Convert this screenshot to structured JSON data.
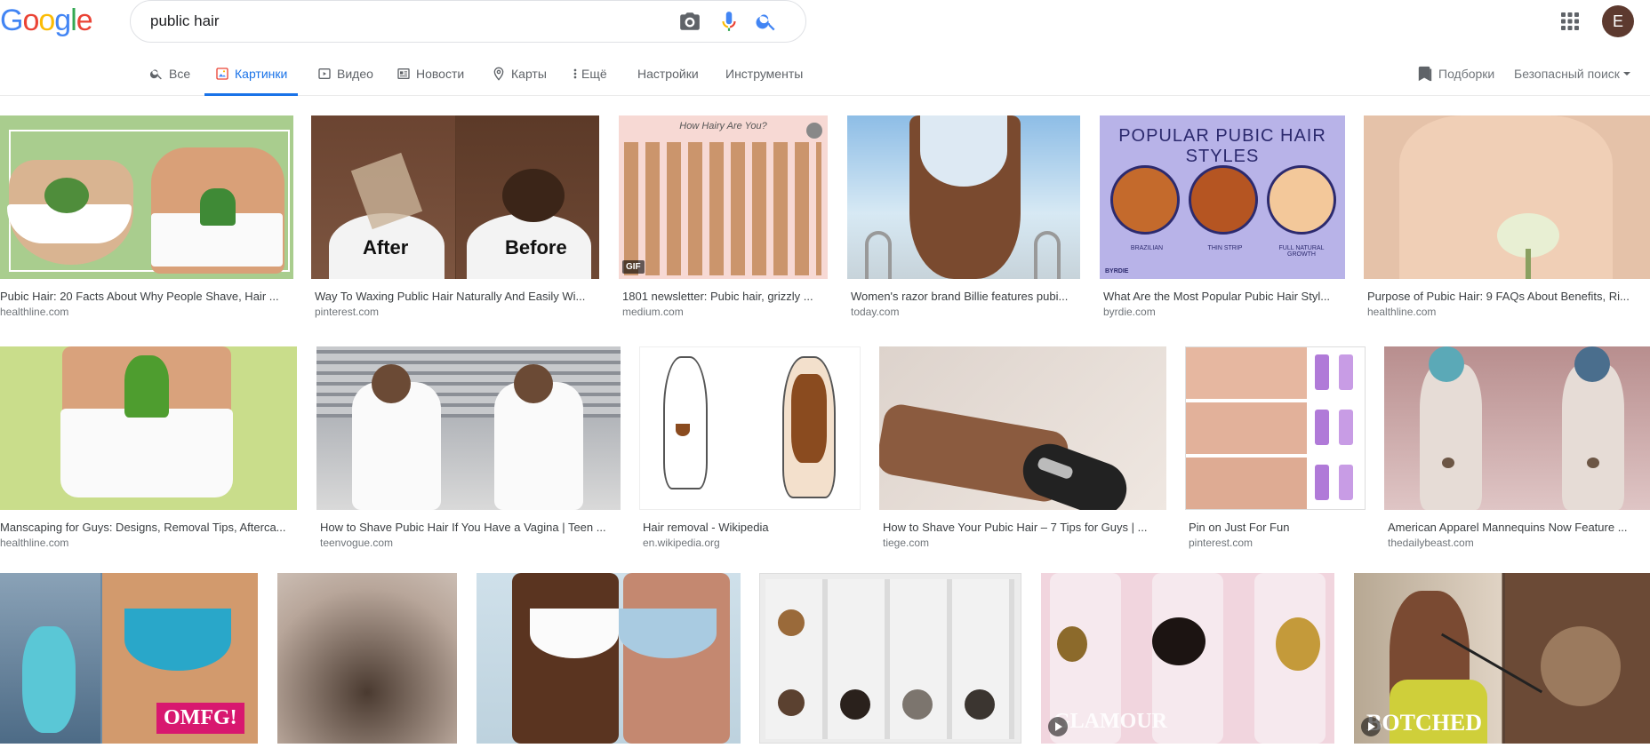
{
  "logo": {
    "letters": [
      "G",
      "o",
      "o",
      "g",
      "l",
      "e"
    ],
    "colors": [
      "#4285F4",
      "#EA4335",
      "#FBBC05",
      "#4285F4",
      "#34A853",
      "#EA4335"
    ]
  },
  "search": {
    "query": "public hair"
  },
  "user": {
    "initial": "E",
    "avatar_color": "#5d3a2f"
  },
  "tabs": [
    {
      "label": "Все",
      "icon": "search-icon"
    },
    {
      "label": "Картинки",
      "icon": "image-icon",
      "active": true
    },
    {
      "label": "Видео",
      "icon": "video-icon"
    },
    {
      "label": "Новости",
      "icon": "news-icon"
    },
    {
      "label": "Карты",
      "icon": "map-pin-icon"
    },
    {
      "label": "Ещё",
      "icon": "more-vert-icon"
    },
    {
      "label": "Настройки"
    },
    {
      "label": "Инструменты"
    }
  ],
  "right_tools": {
    "collections": "Подборки",
    "safe_search": "Безопасный поиск"
  },
  "accent_color": "#1a73e8",
  "results": [
    {
      "caption": "Pubic Hair: 20 Facts About Why People Shave, Hair ...",
      "domain": "healthline.com"
    },
    {
      "caption": "Way To Waxing Public Hair Naturally And Easily Wi...",
      "domain": "pinterest.com",
      "overlay_left": "After",
      "overlay_right": "Before"
    },
    {
      "caption": "1801 newsletter: Pubic hair, grizzly ...",
      "domain": "medium.com",
      "badge": "GIF",
      "image_title": "How Hairy Are You?"
    },
    {
      "caption": "Women's razor brand Billie features pubi...",
      "domain": "today.com"
    },
    {
      "caption": "What Are the Most Popular Pubic Hair Styl...",
      "domain": "byrdie.com",
      "image_title": "POPULAR PUBIC HAIR STYLES",
      "image_labels": [
        "BRAZILIAN",
        "THIN STRIP",
        "FULL NATURAL GROWTH"
      ],
      "image_brand": "BYRDIE"
    },
    {
      "caption": "Purpose of Pubic Hair: 9 FAQs About Benefits, Ri...",
      "domain": "healthline.com"
    },
    {
      "caption": "Manscaping for Guys: Designs, Removal Tips, Afterca...",
      "domain": "healthline.com"
    },
    {
      "caption": "How to Shave Pubic Hair If You Have a Vagina | Teen ...",
      "domain": "teenvogue.com"
    },
    {
      "caption": "Hair removal - Wikipedia",
      "domain": "en.wikipedia.org"
    },
    {
      "caption": "How to Shave Your Pubic Hair – 7 Tips for Guys | ...",
      "domain": "tiege.com"
    },
    {
      "caption": "Pin on Just For Fun",
      "domain": "pinterest.com"
    },
    {
      "caption": "American Apparel Mannequins Now Feature ...",
      "domain": "thedailybeast.com"
    },
    {
      "overlay": "OMFG!"
    },
    {},
    {},
    {},
    {
      "overlay": "GLAMOUR",
      "play": true
    },
    {
      "overlay": "BOTCHED",
      "play": true
    }
  ]
}
